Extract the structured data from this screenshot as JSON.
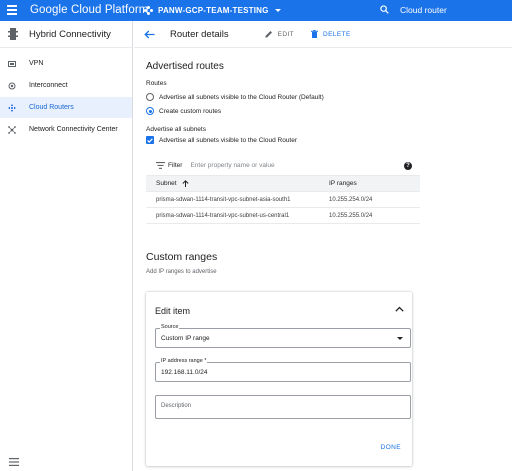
{
  "topbar": {
    "logo": "Google Cloud Platform",
    "project": "PANW-GCP-TEAM-TESTING",
    "search_value": "Cloud router"
  },
  "sidebar": {
    "title": "Hybrid Connectivity",
    "items": [
      {
        "label": "VPN",
        "icon": "vpn-icon",
        "active": false
      },
      {
        "label": "Interconnect",
        "icon": "interconnect-icon",
        "active": false
      },
      {
        "label": "Cloud Routers",
        "icon": "cloud-router-icon",
        "active": true
      },
      {
        "label": "Network Connectivity Center",
        "icon": "network-center-icon",
        "active": false
      }
    ]
  },
  "header": {
    "title": "Router details",
    "edit_label": "EDIT",
    "delete_label": "DELETE"
  },
  "advertised": {
    "title": "Advertised routes",
    "routes_label": "Routes",
    "radio_default": "Advertise all subnets visible to the Cloud Router (Default)",
    "radio_custom": "Create custom routes",
    "selected_radio": "custom",
    "all_subnets_label": "Advertise all subnets",
    "checkbox_label": "Advertise all subnets visible to the Cloud Router",
    "checkbox_checked": true
  },
  "filter": {
    "label": "Filter",
    "placeholder": "Enter property name or value"
  },
  "table": {
    "headers": [
      "Subnet",
      "IP ranges"
    ],
    "rows": [
      [
        "prisma-sdwan-1114-transit-vpc-subnet-asia-south1",
        "10.255.254.0/24"
      ],
      [
        "prisma-sdwan-1114-transit-vpc-subnet-us-central1",
        "10.255.255.0/24"
      ]
    ]
  },
  "custom": {
    "title": "Custom ranges",
    "subtitle": "Add IP ranges to advertise"
  },
  "edit_item": {
    "title": "Edit item",
    "source_label": "Source",
    "source_value": "Custom IP range",
    "ip_label": "IP address range *",
    "ip_value": "192.168.11.0/24",
    "description_placeholder": "Description",
    "done_label": "DONE"
  },
  "colors": {
    "brand": "#1a73e8",
    "active_bg": "#e8f0fe"
  }
}
